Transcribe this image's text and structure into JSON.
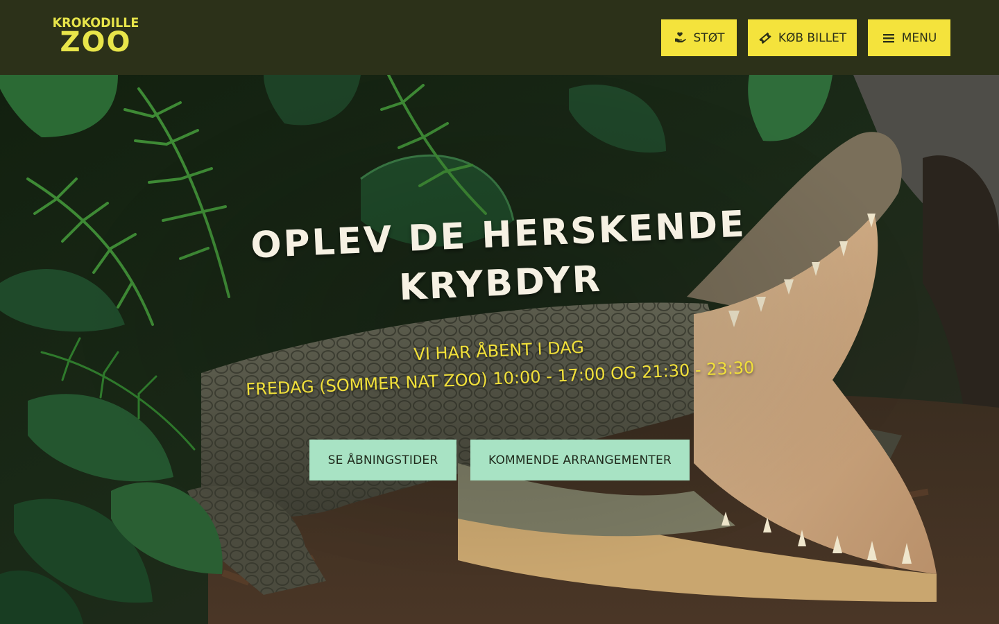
{
  "brand": {
    "logo_top": "KROKODILLE",
    "logo_bottom": "ZOO",
    "color": "#e8e54a"
  },
  "header": {
    "background": "#2c3119",
    "buttons": [
      {
        "label": "STØT",
        "icon": "hand-heart-icon"
      },
      {
        "label": "KØB BILLET",
        "icon": "ticket-icon"
      },
      {
        "label": "MENU",
        "icon": "hamburger-menu-icon"
      }
    ],
    "button_color": "#f4e33c"
  },
  "hero": {
    "title": "OPLEV DE HERSKENDE KRYBDYR",
    "open_today": "VI HAR ÅBENT I DAG",
    "hours_line": "FREDAG (SOMMER NAT ZOO) 10:00 - 17:00 OG 21:30 - 23:30",
    "subtitle_color": "#f1e03a",
    "cta_buttons": [
      {
        "label": "SE ÅBNINGSTIDER"
      },
      {
        "label": "KOMMENDE ARRANGEMENTER"
      }
    ],
    "cta_color": "#a8e3c4",
    "background_image": "crocodile-in-jungle-photo"
  }
}
